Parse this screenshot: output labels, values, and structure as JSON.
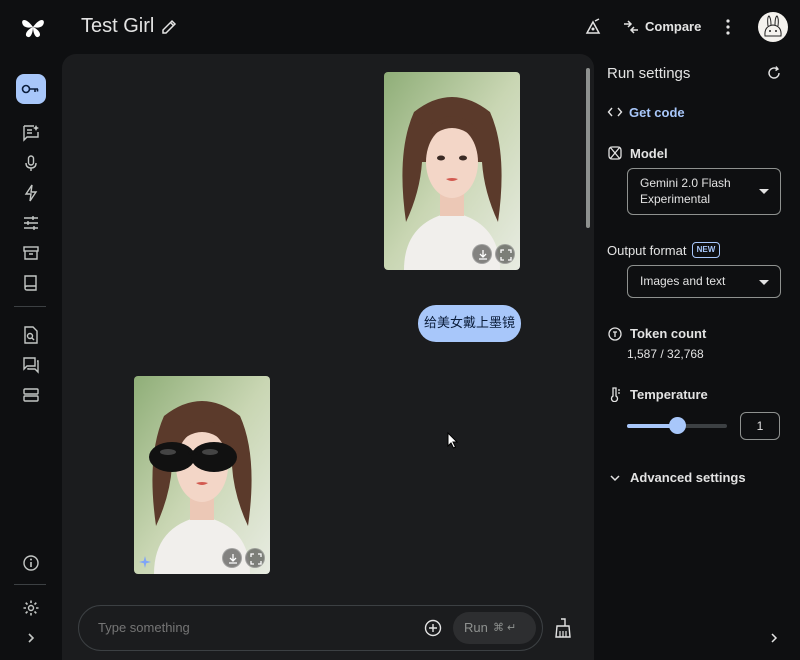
{
  "header": {
    "title": "Test Girl",
    "compare_label": "Compare"
  },
  "chat": {
    "user_message": "给美女戴上墨镜",
    "composer_placeholder": "Type something",
    "run_label": "Run",
    "run_shortcut": "⌘ ↵"
  },
  "settings": {
    "heading": "Run settings",
    "get_code_label": "Get code",
    "model_label": "Model",
    "model_value_line1": "Gemini 2.0 Flash",
    "model_value_line2": "Experimental",
    "output_format_label": "Output format",
    "new_badge": "NEW",
    "output_format_value": "Images and text",
    "token_count_label": "Token count",
    "token_count_value": "1,587 / 32,768",
    "temperature_label": "Temperature",
    "temperature_value": "1",
    "temperature_fraction": 0.5,
    "advanced_label": "Advanced settings"
  },
  "colors": {
    "accent": "#a8c7fa",
    "background": "#0e0f11",
    "chat_surface": "#1b1c1e"
  }
}
